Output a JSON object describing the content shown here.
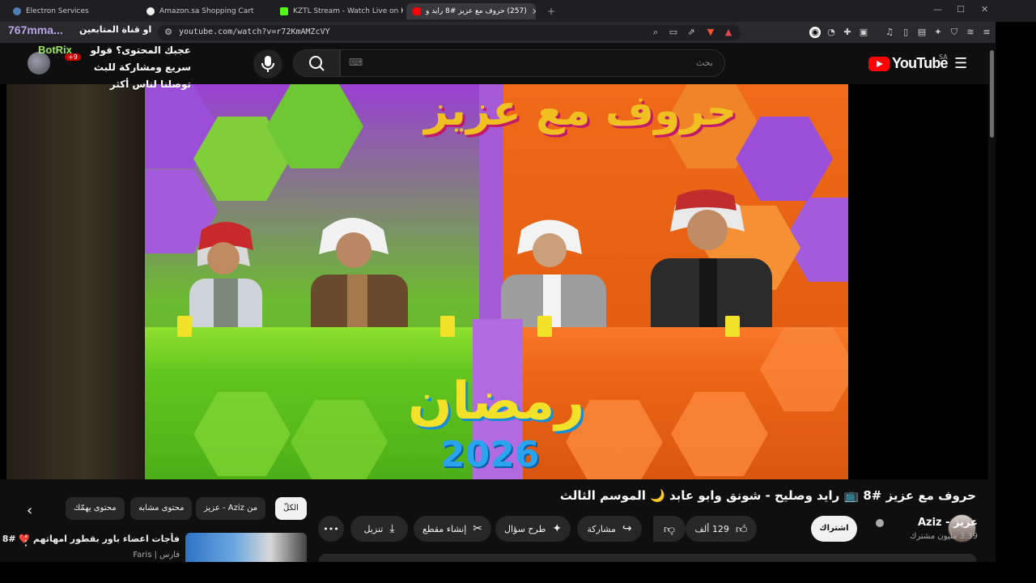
{
  "browser": {
    "tabs": [
      {
        "title": "Electron Services",
        "favicon_color": "#4f7fb5"
      },
      {
        "title": "Amazon.sa Shopping Cart",
        "favicon_color": "#f0f0f0"
      },
      {
        "title": "KZTL Stream - Watch Live on Kick",
        "favicon_color": "#53fc18"
      },
      {
        "title": "(257) حروف مع عزيز #8 رايد و",
        "favicon_color": "#ff0000"
      }
    ],
    "new_tab": "+",
    "url": "youtube.com/watch?v=r72KmAMZcVY",
    "window_controls": {
      "minimize": "—",
      "maximize": "☐",
      "close": "✕"
    }
  },
  "overlay": {
    "username": "767mma...",
    "channel_line": "او قناة المتابعين",
    "message": "عجبك المحتوى؟ فولو سريع ومشاركة للبث توصلنا لناس أكثر",
    "bot_name": "BotRix",
    "badge": "+9"
  },
  "youtube": {
    "logo_text": "YouTube",
    "country": "SA",
    "search_placeholder": "بحث",
    "video": {
      "logo_text": "حروف مع عزيز",
      "ramadan_text": "رمضان",
      "year_text": "2026"
    },
    "title": "حروف مع عزيز #8 📺 رايد وصليح - شونق وابو عابد 🌙 الموسم الثالث",
    "channel": {
      "name": "عزيز - Aziz",
      "subscribers": "3.39 مليون مشترك",
      "subscribe_label": "اشتراك"
    },
    "actions": {
      "likes": "129 ألف",
      "share": "مشاركة",
      "ask": "طرح سؤال",
      "clip": "إنشاء مقطع",
      "download": "تنزيل",
      "more": "•••"
    },
    "chips": [
      {
        "label": "الكلّ",
        "selected": true
      },
      {
        "label": "من Aziz - عزيز",
        "selected": false
      },
      {
        "label": "محتوى مشابه",
        "selected": false
      },
      {
        "label": "محتوى يهمّك",
        "selected": false
      }
    ],
    "recommendation": {
      "title": "فأجات اعضاء باور بقطور امهاتهم ❤️ #8",
      "channel": "فارس | Faris"
    }
  }
}
